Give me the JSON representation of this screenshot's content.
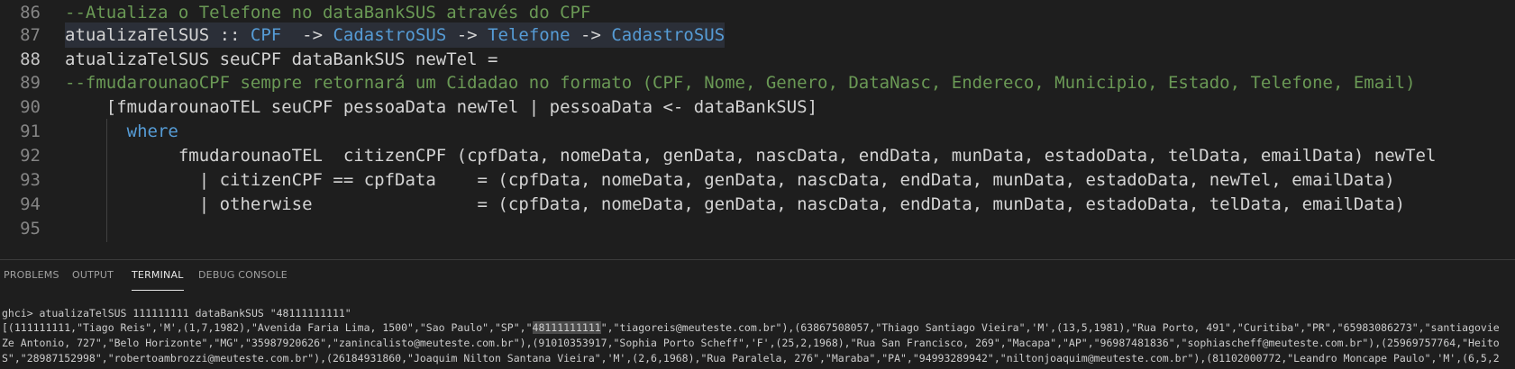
{
  "editor": {
    "lines": [
      {
        "num": "86",
        "parts": [
          {
            "t": "--Atualiza o Telefone no dataBankSUS através do CPF",
            "c": "comment"
          }
        ]
      },
      {
        "num": "87",
        "parts": [
          {
            "t": "atualizaTelSUS",
            "c": "plain"
          },
          {
            "t": " :: ",
            "c": "op"
          },
          {
            "t": "CPF",
            "c": "kw"
          },
          {
            "t": "  -> ",
            "c": "op"
          },
          {
            "t": "CadastroSUS",
            "c": "kw"
          },
          {
            "t": " -> ",
            "c": "op"
          },
          {
            "t": "Telefone",
            "c": "kw"
          },
          {
            "t": " -> ",
            "c": "op"
          },
          {
            "t": "CadastroSUS",
            "c": "kw"
          }
        ]
      },
      {
        "num": "88",
        "parts": [
          {
            "t": "atualizaTelSUS seuCPF dataBankSUS newTel =",
            "c": "plain"
          }
        ]
      },
      {
        "num": "89",
        "parts": [
          {
            "t": "--fmudarounaoCPF sempre retornará um Cidadao no formato (CPF, Nome, Genero, DataNasc, Endereco, Municipio, Estado, Telefone, Email)",
            "c": "comment"
          }
        ]
      },
      {
        "num": "90",
        "parts": [
          {
            "t": "    [fmudarounaoTEL seuCPF pessoaData newTel | pessoaData <- dataBankSUS]",
            "c": "plain"
          }
        ]
      },
      {
        "num": "91",
        "parts": [
          {
            "t": "      ",
            "c": "plain"
          },
          {
            "t": "where",
            "c": "kw"
          }
        ]
      },
      {
        "num": "92",
        "parts": [
          {
            "t": "           fmudarounaoTEL  citizenCPF (cpfData, nomeData, genData, nascData, endData, munData, estadoData, telData, emailData) newTel",
            "c": "plain"
          }
        ]
      },
      {
        "num": "93",
        "parts": [
          {
            "t": "             | citizenCPF == cpfData    = (cpfData, nomeData, genData, nascData, endData, munData, estadoData, newTel, emailData)",
            "c": "plain"
          }
        ]
      },
      {
        "num": "94",
        "parts": [
          {
            "t": "             | otherwise                = (cpfData, nomeData, genData, nascData, endData, munData, estadoData, telData, emailData)",
            "c": "plain"
          }
        ]
      },
      {
        "num": "95",
        "parts": [
          {
            "t": "",
            "c": "plain"
          }
        ]
      }
    ],
    "current_line": "88"
  },
  "panel": {
    "tabs": [
      {
        "label": "PROBLEMS",
        "active": false
      },
      {
        "label": "OUTPUT",
        "active": false
      },
      {
        "label": "TERMINAL",
        "active": true
      },
      {
        "label": "DEBUG CONSOLE",
        "active": false
      }
    ]
  },
  "terminal": {
    "command": "ghci> atualizaTelSUS 111111111 dataBankSUS \"48111111111\"",
    "out1_pre": "[(111111111,\"Tiago Reis\",'M',(1,7,1982),\"Avenida Faria Lima, 1500\",\"Sao Paulo\",\"SP\",\"",
    "out1_sel": "48111111111",
    "out1_post": "\",\"tiagoreis@meuteste.com.br\"),(63867508057,\"Thiago Santiago Vieira\",'M',(13,5,1981),\"Rua Porto, 491\",\"Curitiba\",\"PR\",\"65983086273\",\"santiagovie",
    "out2": "Ze Antonio, 727\",\"Belo Horizonte\",\"MG\",\"35987920626\",\"zanincalisto@meuteste.com.br\"),(91010353917,\"Sophia Porto Scheff\",'F',(25,2,1968),\"Rua San Francisco, 269\",\"Macapa\",\"AP\",\"96987481836\",\"sophiascheff@meuteste.com.br\"),(25969757764,\"Heito",
    "out3": "S\",\"28987152998\",\"robertoambrozzi@meuteste.com.br\"),(26184931860,\"Joaquim Nilton Santana Vieira\",'M',(2,6,1968),\"Rua Paralela, 276\",\"Maraba\",\"PA\",\"94993289942\",\"niltonjoaquim@meuteste.com.br\"),(81102000772,\"Leandro Moncape Paulo\",'M',(6,5,2"
  }
}
